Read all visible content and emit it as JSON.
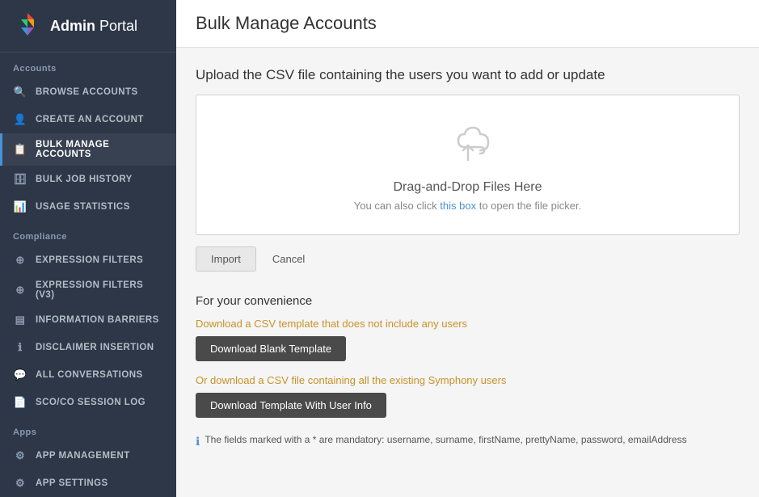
{
  "logo": {
    "brand": "Admin",
    "portal": " Portal"
  },
  "sidebar": {
    "accounts_label": "Accounts",
    "compliance_label": "Compliance",
    "apps_label": "Apps",
    "items_accounts": [
      {
        "id": "browse-accounts",
        "label": "BROWSE ACCOUNTS",
        "icon": "🔍",
        "active": false
      },
      {
        "id": "create-account",
        "label": "CREATE AN ACCOUNT",
        "icon": "👤",
        "active": false
      },
      {
        "id": "bulk-manage",
        "label": "BULK MANAGE ACCOUNTS",
        "icon": "📋",
        "active": true
      },
      {
        "id": "bulk-job-history",
        "label": "BULK JOB HISTORY",
        "icon": "🗄",
        "active": false
      },
      {
        "id": "usage-statistics",
        "label": "USAGE STATISTICS",
        "icon": "📊",
        "active": false
      }
    ],
    "items_compliance": [
      {
        "id": "expression-filters",
        "label": "EXPRESSION FILTERS",
        "icon": "⊕",
        "active": false
      },
      {
        "id": "expression-filters-v3",
        "label": "EXPRESSION FILTERS (V3)",
        "icon": "⊕",
        "active": false
      },
      {
        "id": "information-barriers",
        "label": "INFORMATION BARRIERS",
        "icon": "▤",
        "active": false
      },
      {
        "id": "disclaimer-insertion",
        "label": "DISCLAIMER INSERTION",
        "icon": "ℹ",
        "active": false
      },
      {
        "id": "all-conversations",
        "label": "ALL CONVERSATIONS",
        "icon": "💬",
        "active": false
      },
      {
        "id": "sco-co-session-log",
        "label": "SCO/CO SESSION LOG",
        "icon": "📄",
        "active": false
      }
    ],
    "items_apps": [
      {
        "id": "app-management",
        "label": "APP MANAGEMENT",
        "icon": "⚙",
        "active": false
      },
      {
        "id": "app-settings",
        "label": "APP SETTINGS",
        "icon": "⚙",
        "active": false
      }
    ]
  },
  "page": {
    "title": "Bulk Manage Accounts",
    "upload_label": "Upload the CSV file containing the users you want to add or update",
    "drop_title": "Drag-and-Drop Files Here",
    "drop_sub_prefix": "You can also click ",
    "drop_sub_link": "this box",
    "drop_sub_suffix": " to open the file picker.",
    "import_btn": "Import",
    "cancel_btn": "Cancel",
    "convenience_title": "For your convenience",
    "blank_template_desc": "Download a CSV template that does not include any users",
    "blank_template_btn": "Download Blank Template",
    "user_info_desc": "Or download a CSV file containing all the existing Symphony users",
    "user_info_btn": "Download Template With User Info",
    "mandatory_note": "The fields marked with a * are mandatory: username, surname, firstName, prettyName, password, emailAddress"
  }
}
